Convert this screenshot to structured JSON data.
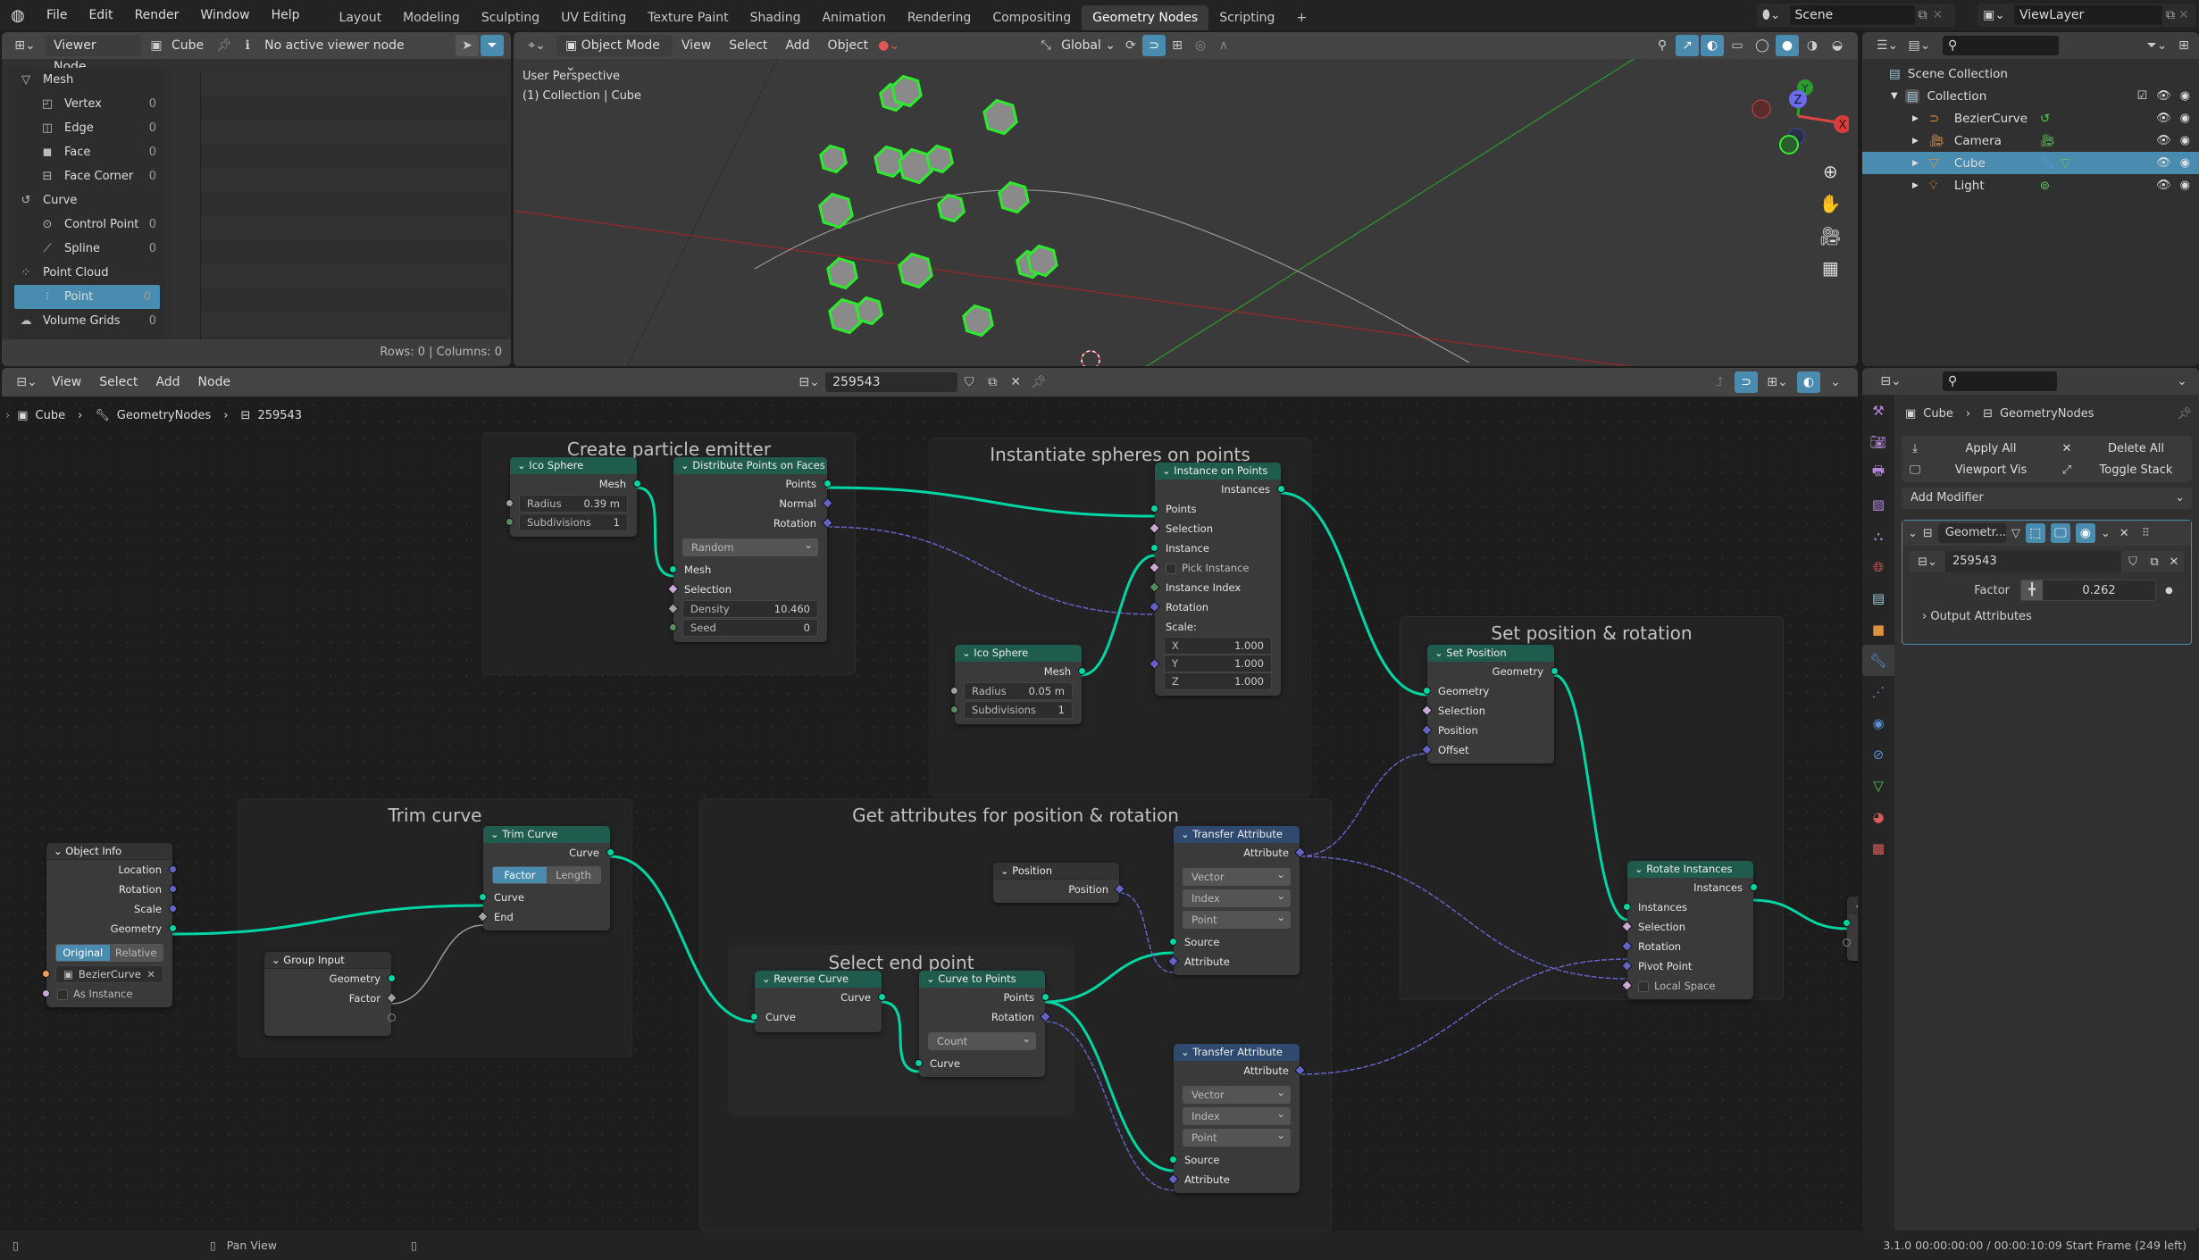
{
  "topbar": {
    "menus": [
      "File",
      "Edit",
      "Render",
      "Window",
      "Help"
    ],
    "workspaces": [
      "Layout",
      "Modeling",
      "Sculpting",
      "UV Editing",
      "Texture Paint",
      "Shading",
      "Animation",
      "Rendering",
      "Compositing",
      "Geometry Nodes",
      "Scripting"
    ],
    "active_workspace": "Geometry Nodes",
    "add_workspace": "+",
    "scene": "Scene",
    "view_layer": "ViewLayer"
  },
  "spreadsheet": {
    "header": {
      "mode": "Viewer Node",
      "object": "Cube",
      "info": "No active viewer node"
    },
    "tree": [
      {
        "label": "Mesh",
        "level": 0,
        "icon": "mesh-icon",
        "count": null
      },
      {
        "label": "Vertex",
        "level": 1,
        "icon": "vertex-icon",
        "count": "0"
      },
      {
        "label": "Edge",
        "level": 1,
        "icon": "edge-icon",
        "count": "0"
      },
      {
        "label": "Face",
        "level": 1,
        "icon": "face-icon",
        "count": "0"
      },
      {
        "label": "Face Corner",
        "level": 1,
        "icon": "face-corner-icon",
        "count": "0"
      },
      {
        "label": "Curve",
        "level": 0,
        "icon": "curve-icon",
        "count": null
      },
      {
        "label": "Control Point",
        "level": 1,
        "icon": "control-point-icon",
        "count": "0"
      },
      {
        "label": "Spline",
        "level": 1,
        "icon": "spline-icon",
        "count": "0"
      },
      {
        "label": "Point Cloud",
        "level": 0,
        "icon": "point-cloud-icon",
        "count": null
      },
      {
        "label": "Point",
        "level": 1,
        "icon": "point-icon",
        "count": "0",
        "selected": true
      },
      {
        "label": "Volume Grids",
        "level": 0,
        "icon": "volume-icon",
        "count": "0"
      }
    ],
    "status": "Rows: 0   |   Columns: 0"
  },
  "viewport": {
    "header": {
      "mode": "Object Mode",
      "menus": [
        "View",
        "Select",
        "Add",
        "Object"
      ],
      "orientation": "Global"
    },
    "overlay_line1": "User Perspective",
    "overlay_line2": "(1) Collection | Cube",
    "gizmo": {
      "x": "X",
      "y": "Y",
      "z": "Z"
    }
  },
  "outliner": {
    "root": "Scene Collection",
    "collection": "Collection",
    "items": [
      {
        "name": "BezierCurve",
        "icon": "curve-object-icon",
        "color": "#e0913e"
      },
      {
        "name": "Camera",
        "icon": "camera-object-icon",
        "color": "#e0913e"
      },
      {
        "name": "Cube",
        "icon": "mesh-object-icon",
        "color": "#e0913e",
        "selected": true
      },
      {
        "name": "Light",
        "icon": "light-object-icon",
        "color": "#e0913e"
      }
    ]
  },
  "node_editor": {
    "menus": [
      "View",
      "Select",
      "Add",
      "Node"
    ],
    "tree_name": "259543",
    "breadcrumb": [
      "Cube",
      "GeometryNodes",
      "259543"
    ],
    "frames": {
      "emitter": "Create particle emitter",
      "instantiate": "Instantiate spheres on points",
      "setpos": "Set position & rotation",
      "trim": "Trim curve",
      "attrs": "Get attributes for position & rotation",
      "endpoint": "Select end point"
    },
    "nodes": {
      "ico1": {
        "title": "Ico Sphere",
        "out": "Mesh",
        "radius_label": "Radius",
        "radius": "0.39 m",
        "subdiv_label": "Subdivisions",
        "subdiv": "1"
      },
      "distribute": {
        "title": "Distribute Points on Faces",
        "outs": [
          "Points",
          "Normal",
          "Rotation"
        ],
        "mode": "Random",
        "ins": [
          "Mesh",
          "Selection"
        ],
        "density_label": "Density",
        "density": "10.460",
        "seed_label": "Seed",
        "seed": "0"
      },
      "ico2": {
        "title": "Ico Sphere",
        "out": "Mesh",
        "radius_label": "Radius",
        "radius": "0.05 m",
        "subdiv_label": "Subdivisions",
        "subdiv": "1"
      },
      "instance": {
        "title": "Instance on Points",
        "out": "Instances",
        "ins": [
          "Points",
          "Selection",
          "Instance",
          "Pick Instance",
          "Instance Index",
          "Rotation"
        ],
        "scale_label": "Scale:",
        "scale": [
          {
            "axis": "X",
            "v": "1.000"
          },
          {
            "axis": "Y",
            "v": "1.000"
          },
          {
            "axis": "Z",
            "v": "1.000"
          }
        ]
      },
      "setpos": {
        "title": "Set Position",
        "out": "Geometry",
        "ins": [
          "Geometry",
          "Selection",
          "Position",
          "Offset"
        ]
      },
      "objinfo": {
        "title": "Object Info",
        "outs": [
          "Location",
          "Rotation",
          "Scale",
          "Geometry"
        ],
        "seg": [
          "Original",
          "Relative"
        ],
        "object": "BezierCurve",
        "as_instance": "As Instance"
      },
      "trim": {
        "title": "Trim Curve",
        "out": "Curve",
        "seg": [
          "Factor",
          "Length"
        ],
        "ins": [
          "Curve",
          "End"
        ]
      },
      "groupin": {
        "title": "Group Input",
        "outs": [
          "Geometry",
          "Factor"
        ]
      },
      "reverse": {
        "title": "Reverse Curve",
        "out": "Curve",
        "in": "Curve"
      },
      "c2p": {
        "title": "Curve to Points",
        "outs": [
          "Points",
          "Rotation"
        ],
        "mode": "Count",
        "in": "Curve"
      },
      "position": {
        "title": "Position",
        "out": "Position"
      },
      "transfer1": {
        "title": "Transfer Attribute",
        "out": "Attribute",
        "dds": [
          "Vector",
          "Index",
          "Point"
        ],
        "ins": [
          "Source",
          "Attribute"
        ]
      },
      "transfer2": {
        "title": "Transfer Attribute",
        "out": "Attribute",
        "dds": [
          "Vector",
          "Index",
          "Point"
        ],
        "ins": [
          "Source",
          "Attribute"
        ]
      },
      "rotate": {
        "title": "Rotate Instances",
        "out": "Instances",
        "ins": [
          "Instances",
          "Selection",
          "Rotation",
          "Pivot Point",
          "Local Space"
        ]
      }
    }
  },
  "properties": {
    "breadcrumb": [
      "Cube",
      "GeometryNodes"
    ],
    "apply_all": "Apply All",
    "delete_all": "Delete All",
    "viewport_vis": "Viewport Vis",
    "toggle_stack": "Toggle Stack",
    "add_modifier": "Add Modifier",
    "modifier_name": "Geometr...",
    "node_group": "259543",
    "factor_label": "Factor",
    "factor_value": "0.262",
    "output_attributes": "Output Attributes"
  },
  "statusbar": {
    "pan_view": "Pan View",
    "version_info": "3.1.0   00:00:00:00 / 00:00:10:09   Start Frame (249 left)"
  },
  "colors": {
    "accent": "#4a8bb0",
    "geometry_socket": "#00d6a3",
    "vector_socket": "#6363c7",
    "geometry_node_header": "#1f5c4e",
    "converter_node_header": "#2f4a6e"
  }
}
